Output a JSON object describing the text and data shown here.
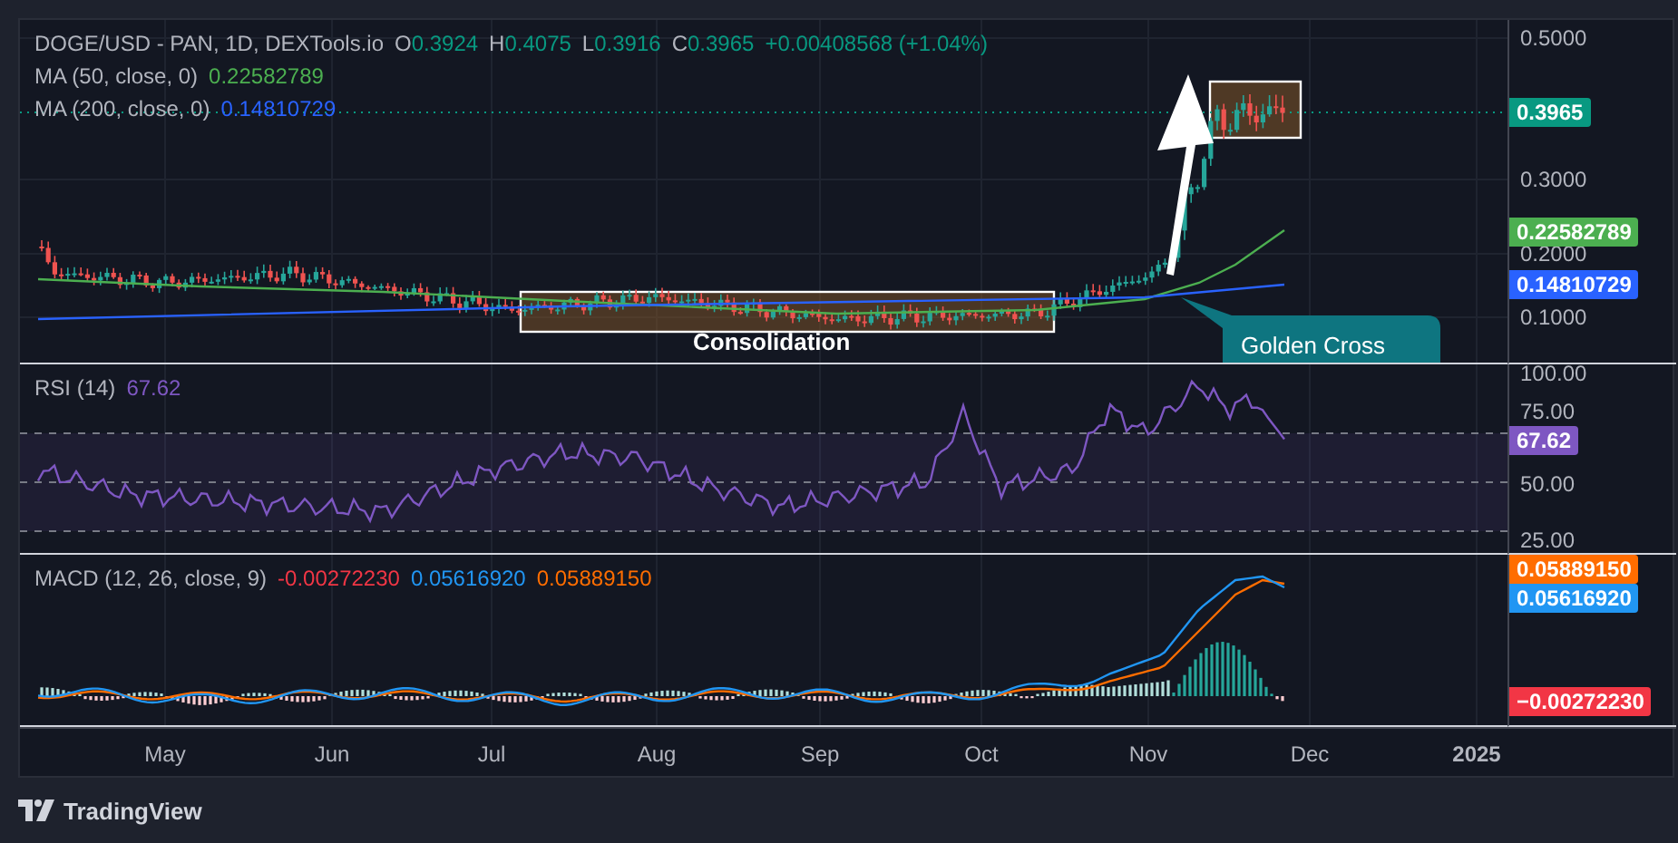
{
  "header": {
    "symbol": "DOGE/USD - PAN, 1D, DEXTools.io",
    "ohlc": [
      {
        "label": "O",
        "value": "0.3924"
      },
      {
        "label": "H",
        "value": "0.4075"
      },
      {
        "label": "L",
        "value": "0.3916"
      },
      {
        "label": "C",
        "value": "0.3965"
      }
    ],
    "change": "+0.00408568 (+1.04%)"
  },
  "moving_averages": [
    {
      "label": "MA (50, close, 0)",
      "value": "0.22582789",
      "color": "#4caf50"
    },
    {
      "label": "MA (200, close, 0)",
      "value": "0.14810729",
      "color": "#2962ff"
    }
  ],
  "consolidation": {
    "label": "Consolidation"
  },
  "callout": {
    "label": "Golden Cross"
  },
  "price_axis": {
    "ticks": [
      "0.5000",
      "0.3000",
      "0.2000",
      "0.1000"
    ],
    "tags": [
      {
        "value": "0.3965",
        "color": "#089981"
      },
      {
        "value": "0.22582789",
        "color": "#4caf50"
      },
      {
        "value": "0.14810729",
        "color": "#2962ff"
      }
    ]
  },
  "rsi": {
    "label": "RSI (14)",
    "value": "67.62",
    "ticks": [
      "100.00",
      "75.00",
      "50.00",
      "25.00"
    ],
    "tag": "67.62"
  },
  "macd": {
    "label": "MACD (12, 26, close, 9)",
    "values": [
      {
        "value": "-0.00272230",
        "color": "#f23645"
      },
      {
        "value": "0.05616920",
        "color": "#2196f3"
      },
      {
        "value": "0.05889150",
        "color": "#ff6d00"
      }
    ],
    "tags": [
      {
        "value": "0.05889150",
        "color": "#ff6d00"
      },
      {
        "value": "0.05616920",
        "color": "#2196f3"
      },
      {
        "value": "−0.00272230",
        "color": "#f23645"
      }
    ]
  },
  "time_axis": [
    {
      "label": "May",
      "bold": false
    },
    {
      "label": "Jun",
      "bold": false
    },
    {
      "label": "Jul",
      "bold": false
    },
    {
      "label": "Aug",
      "bold": false
    },
    {
      "label": "Sep",
      "bold": false
    },
    {
      "label": "Oct",
      "bold": false
    },
    {
      "label": "Nov",
      "bold": false
    },
    {
      "label": "Dec",
      "bold": false
    },
    {
      "label": "2025",
      "bold": true
    }
  ],
  "footer": {
    "brand": "TradingView"
  }
}
